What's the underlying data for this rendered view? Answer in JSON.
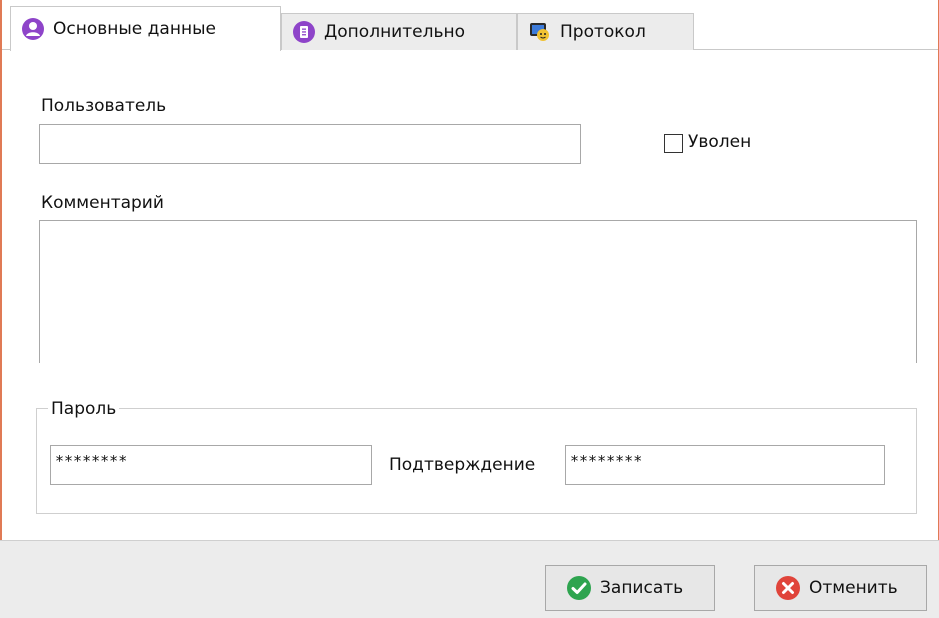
{
  "tabs": [
    {
      "label": "Основные данные",
      "icon": "user-icon",
      "active": true
    },
    {
      "label": "Дополнительно",
      "icon": "list-icon",
      "active": false
    },
    {
      "label": "Протокол",
      "icon": "protocol-icon",
      "active": false
    }
  ],
  "form": {
    "user_label": "Пользователь",
    "user_value": "",
    "fired_label": "Уволен",
    "fired_checked": false,
    "comment_label": "Комментарий",
    "comment_value": "",
    "password_group_label": "Пароль",
    "password_value": "********",
    "confirm_label": "Подтверждение",
    "confirm_value": "********"
  },
  "buttons": {
    "save_label": "Записать",
    "cancel_label": "Отменить"
  },
  "colors": {
    "accent_frame": "#e07a55",
    "purple_icon": "#8e44c9",
    "save_green": "#2ea44f",
    "cancel_red": "#e0443a"
  }
}
